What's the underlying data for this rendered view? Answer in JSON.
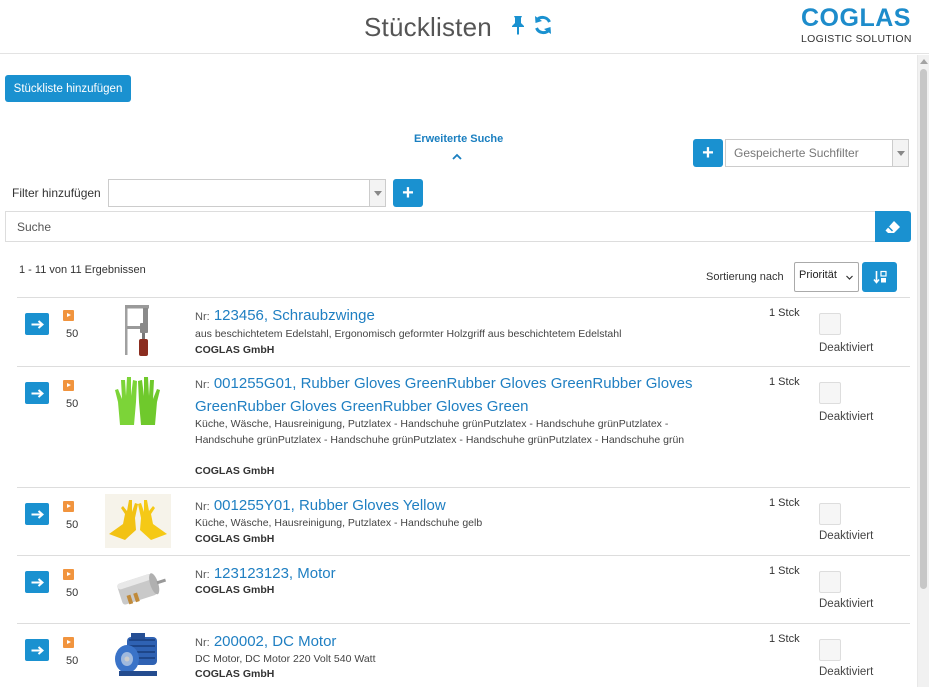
{
  "header": {
    "title": "Stücklisten",
    "logo_main": "COGLAS",
    "logo_sub": "LOGISTIC SOLUTION"
  },
  "toolbar": {
    "add_list_label": "Stückliste hinzufügen"
  },
  "search": {
    "advanced_label": "Erweiterte Suche",
    "saved_filter_placeholder": "Gespeicherte Suchfilter",
    "filter_add_label": "Filter hinzufügen",
    "search_placeholder": "Suche",
    "add_symbol": "+"
  },
  "results": {
    "count_text": "1 - 11 von 11 Ergebnissen",
    "sort_label": "Sortierung nach",
    "sort_value": "Priorität"
  },
  "items": [
    {
      "priority": "50",
      "nr_prefix": "Nr:",
      "nr": "123456,",
      "name": "Schraubzwinge",
      "description": "aus beschichtetem Edelstahl, Ergonomisch geformter Holzgriff aus beschichtetem Edelstahl",
      "company": "COGLAS GmbH",
      "quantity": "1 Stck",
      "status": "Deaktiviert",
      "image_icon": "clamp-image"
    },
    {
      "priority": "50",
      "nr_prefix": "Nr:",
      "nr": "001255G01,",
      "name": "Rubber Gloves GreenRubber Gloves GreenRubber Gloves GreenRubber Gloves GreenRubber Gloves Green",
      "description": "Küche, Wäsche, Hausreinigung, Putzlatex - Handschuhe grünPutzlatex - Handschuhe grünPutzlatex - Handschuhe grünPutzlatex - Handschuhe grünPutzlatex - Handschuhe grünPutzlatex - Handschuhe grün",
      "company": "COGLAS GmbH",
      "quantity": "1 Stck",
      "status": "Deaktiviert",
      "image_icon": "green-gloves-image"
    },
    {
      "priority": "50",
      "nr_prefix": "Nr:",
      "nr": "001255Y01,",
      "name": "Rubber Gloves Yellow",
      "description": "Küche, Wäsche, Hausreinigung, Putzlatex - Handschuhe gelb",
      "company": "COGLAS GmbH",
      "quantity": "1 Stck",
      "status": "Deaktiviert",
      "image_icon": "yellow-gloves-image"
    },
    {
      "priority": "50",
      "nr_prefix": "Nr:",
      "nr": "123123123,",
      "name": "Motor",
      "description": "",
      "company": "COGLAS GmbH",
      "quantity": "1 Stck",
      "status": "Deaktiviert",
      "image_icon": "dc-motor-small-image"
    },
    {
      "priority": "50",
      "nr_prefix": "Nr:",
      "nr": "200002,",
      "name": "DC Motor",
      "description": "DC Motor, DC Motor 220 Volt 540 Watt",
      "company": "COGLAS GmbH",
      "quantity": "1 Stck",
      "status": "Deaktiviert",
      "image_icon": "electric-motor-image"
    }
  ],
  "colors": {
    "primary": "#1a91d0",
    "link": "#1f7fc2",
    "priority": "#f1943e"
  }
}
